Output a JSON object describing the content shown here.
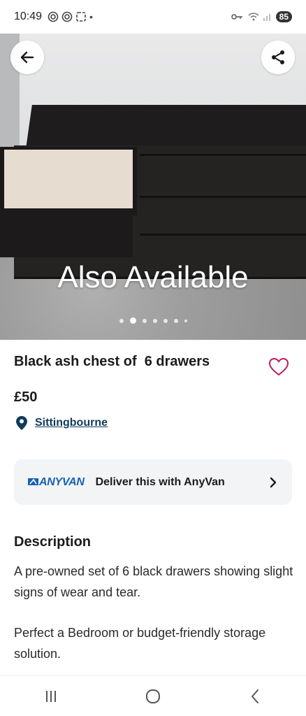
{
  "status_bar": {
    "time": "10:49",
    "battery": "85",
    "dot": "•"
  },
  "hero": {
    "overlay_text": "Also Available",
    "image_count": 7,
    "active_index": 1
  },
  "listing": {
    "title": "Black ash chest of  6 drawers",
    "price": "£50",
    "location": "Sittingbourne"
  },
  "anyvan": {
    "logo": "ANYVAN",
    "label": "Deliver this with AnyVan"
  },
  "description": {
    "heading": "Description",
    "paragraph_1": "A pre-owned set of 6 black drawers showing slight signs of wear and tear.",
    "paragraph_2": "Perfect a Bedroom or budget-friendly storage solution."
  },
  "icons": {
    "back": "arrow-left-icon",
    "share": "share-icon",
    "favourite": "heart-outline-icon",
    "location": "map-pin-icon",
    "chevron": "chevron-right-icon",
    "nav_recents": "recents-icon",
    "nav_home": "home-icon",
    "nav_back": "nav-back-icon"
  },
  "colors": {
    "heart": "#c2185b",
    "link": "#0f3b5c",
    "anyvan_brand": "#1663b3",
    "card_bg": "#f3f4f5"
  }
}
